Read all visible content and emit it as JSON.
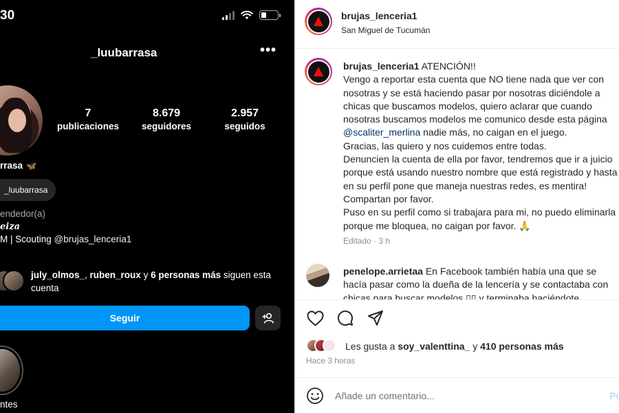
{
  "phone": {
    "status_time": "30",
    "username": "_luubarrasa",
    "more_icon": "•••",
    "stats": [
      {
        "value": "7",
        "label": "publicaciones"
      },
      {
        "value": "8.679",
        "label": "seguidores"
      },
      {
        "value": "2.957",
        "label": "seguidos"
      }
    ],
    "display_name": "rrasa",
    "display_name_emoji": "🦋",
    "threads_handle": "_luubarrasa",
    "category": "endedor(a)",
    "bio_line1": "eiza",
    "bio_line2_prefix": "M | Scouting ",
    "bio_line2_mention": "@brujas_lenceria1",
    "followed_by": {
      "user1": "july_olmos_",
      "sep1": ", ",
      "user2": "ruben_roux",
      "mid": " y ",
      "others": "6 personas más",
      "suffix": " siguen esta cuenta"
    },
    "follow_button": "Seguir",
    "highlight_label": "ntes"
  },
  "post": {
    "author": "brujas_lenceria1",
    "location": "San Miguel de Tucumán",
    "caption": {
      "username": "brujas_lenceria1",
      "lines": [
        " ATENCIÓN!!",
        "Vengo a reportar esta cuenta que NO tiene nada que ver con",
        "nosotras y se está haciendo pasar por nosotras diciéndole a",
        "chicas que buscamos modelos, quiero aclarar que cuando",
        "nosotras buscamos modelos me comunico desde esta página"
      ],
      "mention": "@scaliter_merlina",
      "mention_suffix": " nadie más, no caigan en el juego.",
      "lines_after": [
        "Gracias, las quiero y nos cuidemos entre todas.",
        "Denuncien la cuenta de ella por favor, tendremos que ir a juicio",
        "porque está usando nuestro nombre que está registrado y hasta",
        "en su perfil pone que maneja nuestras redes, es mentira!",
        "Compartan por favor.",
        "Puso en su perfil como si trabajara para mi, no puedo eliminarla",
        "porque me bloquea, no caigan por favor. 🙏"
      ],
      "meta": "Editado · 3 h"
    },
    "comment": {
      "username": "penelope.arrietaa",
      "lines": [
        " En Facebook también había una que se",
        "hacía pasar como la dueña de la lencería y se contactaba con",
        "chicas para buscar modelos ▯▯ y terminaba haciéndote"
      ]
    },
    "likes": {
      "prefix": "Les gusta a ",
      "user": "soy_valenttina_",
      "mid": " y ",
      "others": "410 personas más"
    },
    "time": "Hace 3 horas",
    "comment_placeholder": "Añade un comentario...",
    "publish_label": "Pu"
  }
}
